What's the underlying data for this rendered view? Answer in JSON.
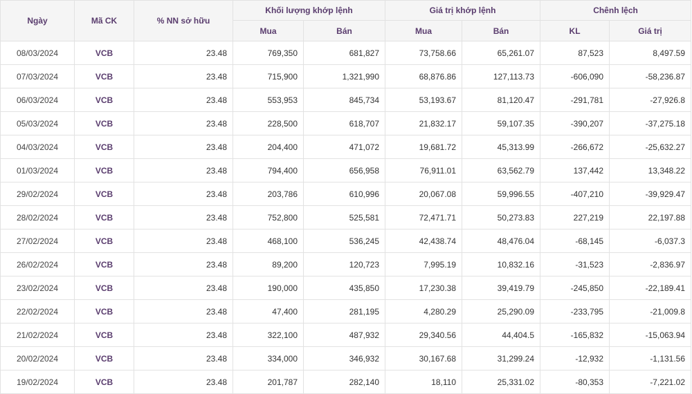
{
  "colors": {
    "header_text": "#5a3d6e",
    "header_bg": "#f5f5f5",
    "border": "#e2e2e2",
    "code_text": "#5a3d6e"
  },
  "header": {
    "date": "Ngày",
    "code": "Mã CK",
    "foreign_pct": "% NN sở hữu",
    "volume_group": "Khối lượng khớp lệnh",
    "value_group": "Giá trị khớp lệnh",
    "diff_group": "Chênh lệch",
    "buy": "Mua",
    "sell": "Bán",
    "kl": "KL",
    "value": "Giá trị"
  },
  "rows": [
    [
      "08/03/2024",
      "VCB",
      "23.48",
      "769,350",
      "681,827",
      "73,758.66",
      "65,261.07",
      "87,523",
      "8,497.59"
    ],
    [
      "07/03/2024",
      "VCB",
      "23.48",
      "715,900",
      "1,321,990",
      "68,876.86",
      "127,113.73",
      "-606,090",
      "-58,236.87"
    ],
    [
      "06/03/2024",
      "VCB",
      "23.48",
      "553,953",
      "845,734",
      "53,193.67",
      "81,120.47",
      "-291,781",
      "-27,926.8"
    ],
    [
      "05/03/2024",
      "VCB",
      "23.48",
      "228,500",
      "618,707",
      "21,832.17",
      "59,107.35",
      "-390,207",
      "-37,275.18"
    ],
    [
      "04/03/2024",
      "VCB",
      "23.48",
      "204,400",
      "471,072",
      "19,681.72",
      "45,313.99",
      "-266,672",
      "-25,632.27"
    ],
    [
      "01/03/2024",
      "VCB",
      "23.48",
      "794,400",
      "656,958",
      "76,911.01",
      "63,562.79",
      "137,442",
      "13,348.22"
    ],
    [
      "29/02/2024",
      "VCB",
      "23.48",
      "203,786",
      "610,996",
      "20,067.08",
      "59,996.55",
      "-407,210",
      "-39,929.47"
    ],
    [
      "28/02/2024",
      "VCB",
      "23.48",
      "752,800",
      "525,581",
      "72,471.71",
      "50,273.83",
      "227,219",
      "22,197.88"
    ],
    [
      "27/02/2024",
      "VCB",
      "23.48",
      "468,100",
      "536,245",
      "42,438.74",
      "48,476.04",
      "-68,145",
      "-6,037.3"
    ],
    [
      "26/02/2024",
      "VCB",
      "23.48",
      "89,200",
      "120,723",
      "7,995.19",
      "10,832.16",
      "-31,523",
      "-2,836.97"
    ],
    [
      "23/02/2024",
      "VCB",
      "23.48",
      "190,000",
      "435,850",
      "17,230.38",
      "39,419.79",
      "-245,850",
      "-22,189.41"
    ],
    [
      "22/02/2024",
      "VCB",
      "23.48",
      "47,400",
      "281,195",
      "4,280.29",
      "25,290.09",
      "-233,795",
      "-21,009.8"
    ],
    [
      "21/02/2024",
      "VCB",
      "23.48",
      "322,100",
      "487,932",
      "29,340.56",
      "44,404.5",
      "-165,832",
      "-15,063.94"
    ],
    [
      "20/02/2024",
      "VCB",
      "23.48",
      "334,000",
      "346,932",
      "30,167.68",
      "31,299.24",
      "-12,932",
      "-1,131.56"
    ],
    [
      "19/02/2024",
      "VCB",
      "23.48",
      "201,787",
      "282,140",
      "18,110",
      "25,331.02",
      "-80,353",
      "-7,221.02"
    ]
  ]
}
